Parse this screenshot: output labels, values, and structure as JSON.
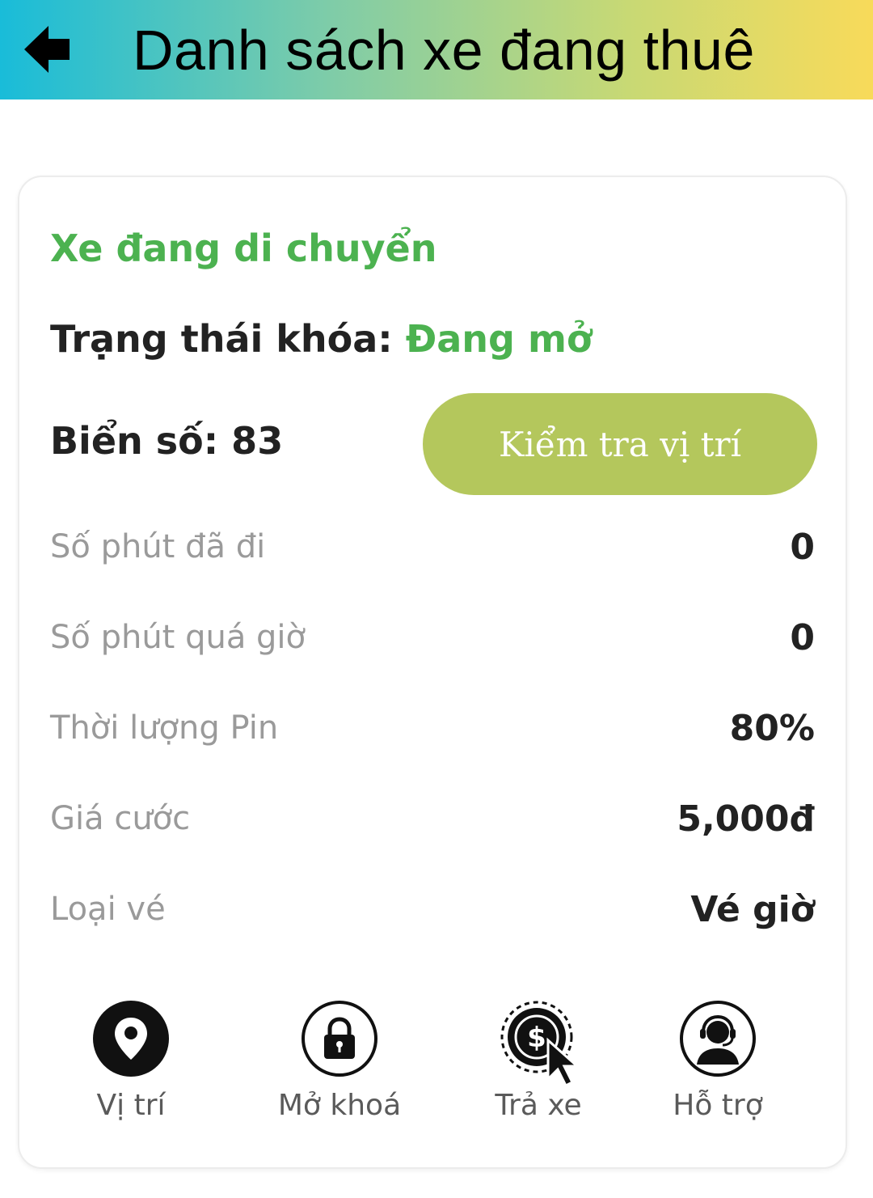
{
  "header": {
    "title": "Danh sách xe đang thuê",
    "back_icon": "back-arrow-icon",
    "gradient": [
      "#19bcd9",
      "#f8da5a"
    ]
  },
  "card": {
    "status_title": "Xe đang di chuyển",
    "lock_label": "Trạng thái khóa:",
    "lock_value": "Đang mở",
    "plate_label": "Biển số: 83",
    "check_location_button": "Kiểm tra vị trí",
    "rows": [
      {
        "label": "Số phút đã đi",
        "value": "0"
      },
      {
        "label": "Số phút quá giờ",
        "value": "0"
      },
      {
        "label": "Thời lượng Pin",
        "value": "80%"
      },
      {
        "label": "Giá cước",
        "value": "5,000đ"
      },
      {
        "label": "Loại vé",
        "value": "Vé giờ"
      }
    ],
    "actions": [
      {
        "label": "Vị trí",
        "icon": "location-pin-icon"
      },
      {
        "label": "Mở khoá",
        "icon": "lock-icon"
      },
      {
        "label": "Trả xe",
        "icon": "pay-cursor-icon"
      },
      {
        "label": "Hỗ trợ",
        "icon": "support-agent-icon"
      }
    ]
  },
  "colors": {
    "accent_green": "#4cb250",
    "button_green": "#b4c75c",
    "text_dark": "#222222",
    "text_muted": "#9a9a9a"
  }
}
